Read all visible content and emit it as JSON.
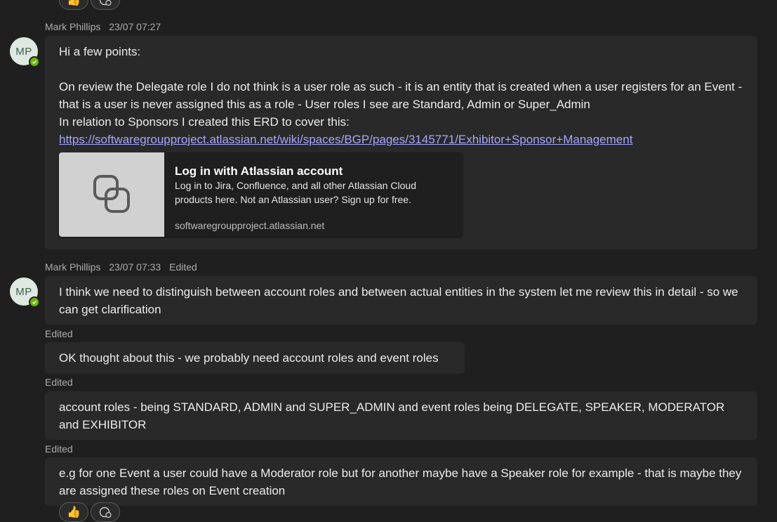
{
  "reactions": {
    "top_thumb": "👍",
    "bottom_thumb": "👍",
    "add_icon": "add-reaction-icon"
  },
  "messages": [
    {
      "author": "Mark Phillips",
      "avatar": "MP",
      "time": "23/07 07:27",
      "lines": [
        "Hi a few points:",
        "On review the Delegate role I do not think is a user role as such - it is an entity that is created when a user registers for an Event - that is a user is never assigned this as a role - User roles I see are Standard, Admin or Super_Admin",
        "In relation to Sponsors I created this ERD to cover this:"
      ],
      "link": "https://softwaregroupproject.atlassian.net/wiki/spaces/BGP/pages/3145771/Exhibitor+Sponsor+Management",
      "card": {
        "title": "Log in with Atlassian account",
        "description": "Log in to Jira, Confluence, and all other Atlassian Cloud products here. Not an Atlassian user? Sign up for free.",
        "domain": "softwaregroupproject.atlassian.net",
        "icon": "link-chain-icon"
      }
    },
    {
      "author": "Mark Phillips",
      "avatar": "MP",
      "time": "23/07 07:33",
      "edited": "Edited",
      "text": "I think we need to distinguish between account roles and between actual entities in the system let me review this in detail - so we can get clarification"
    }
  ],
  "followups": [
    {
      "edited": "Edited",
      "text": "OK thought about this - we probably need account roles and event roles"
    },
    {
      "edited": "Edited",
      "text": "account roles - being STANDARD, ADMIN and SUPER_ADMIN and event roles being DELEGATE, SPEAKER, MODERATOR and EXHIBITOR"
    },
    {
      "edited": "Edited",
      "text": "e.g for one Event a user could have  a Moderator role  but for another maybe have  a Speaker role for example  - that is maybe they are assigned these roles on Event creation"
    }
  ],
  "colors": {
    "background": "#1f1f1f",
    "bubble": "#292929",
    "link": "#a6a7ff",
    "presence": "#6bb700"
  }
}
